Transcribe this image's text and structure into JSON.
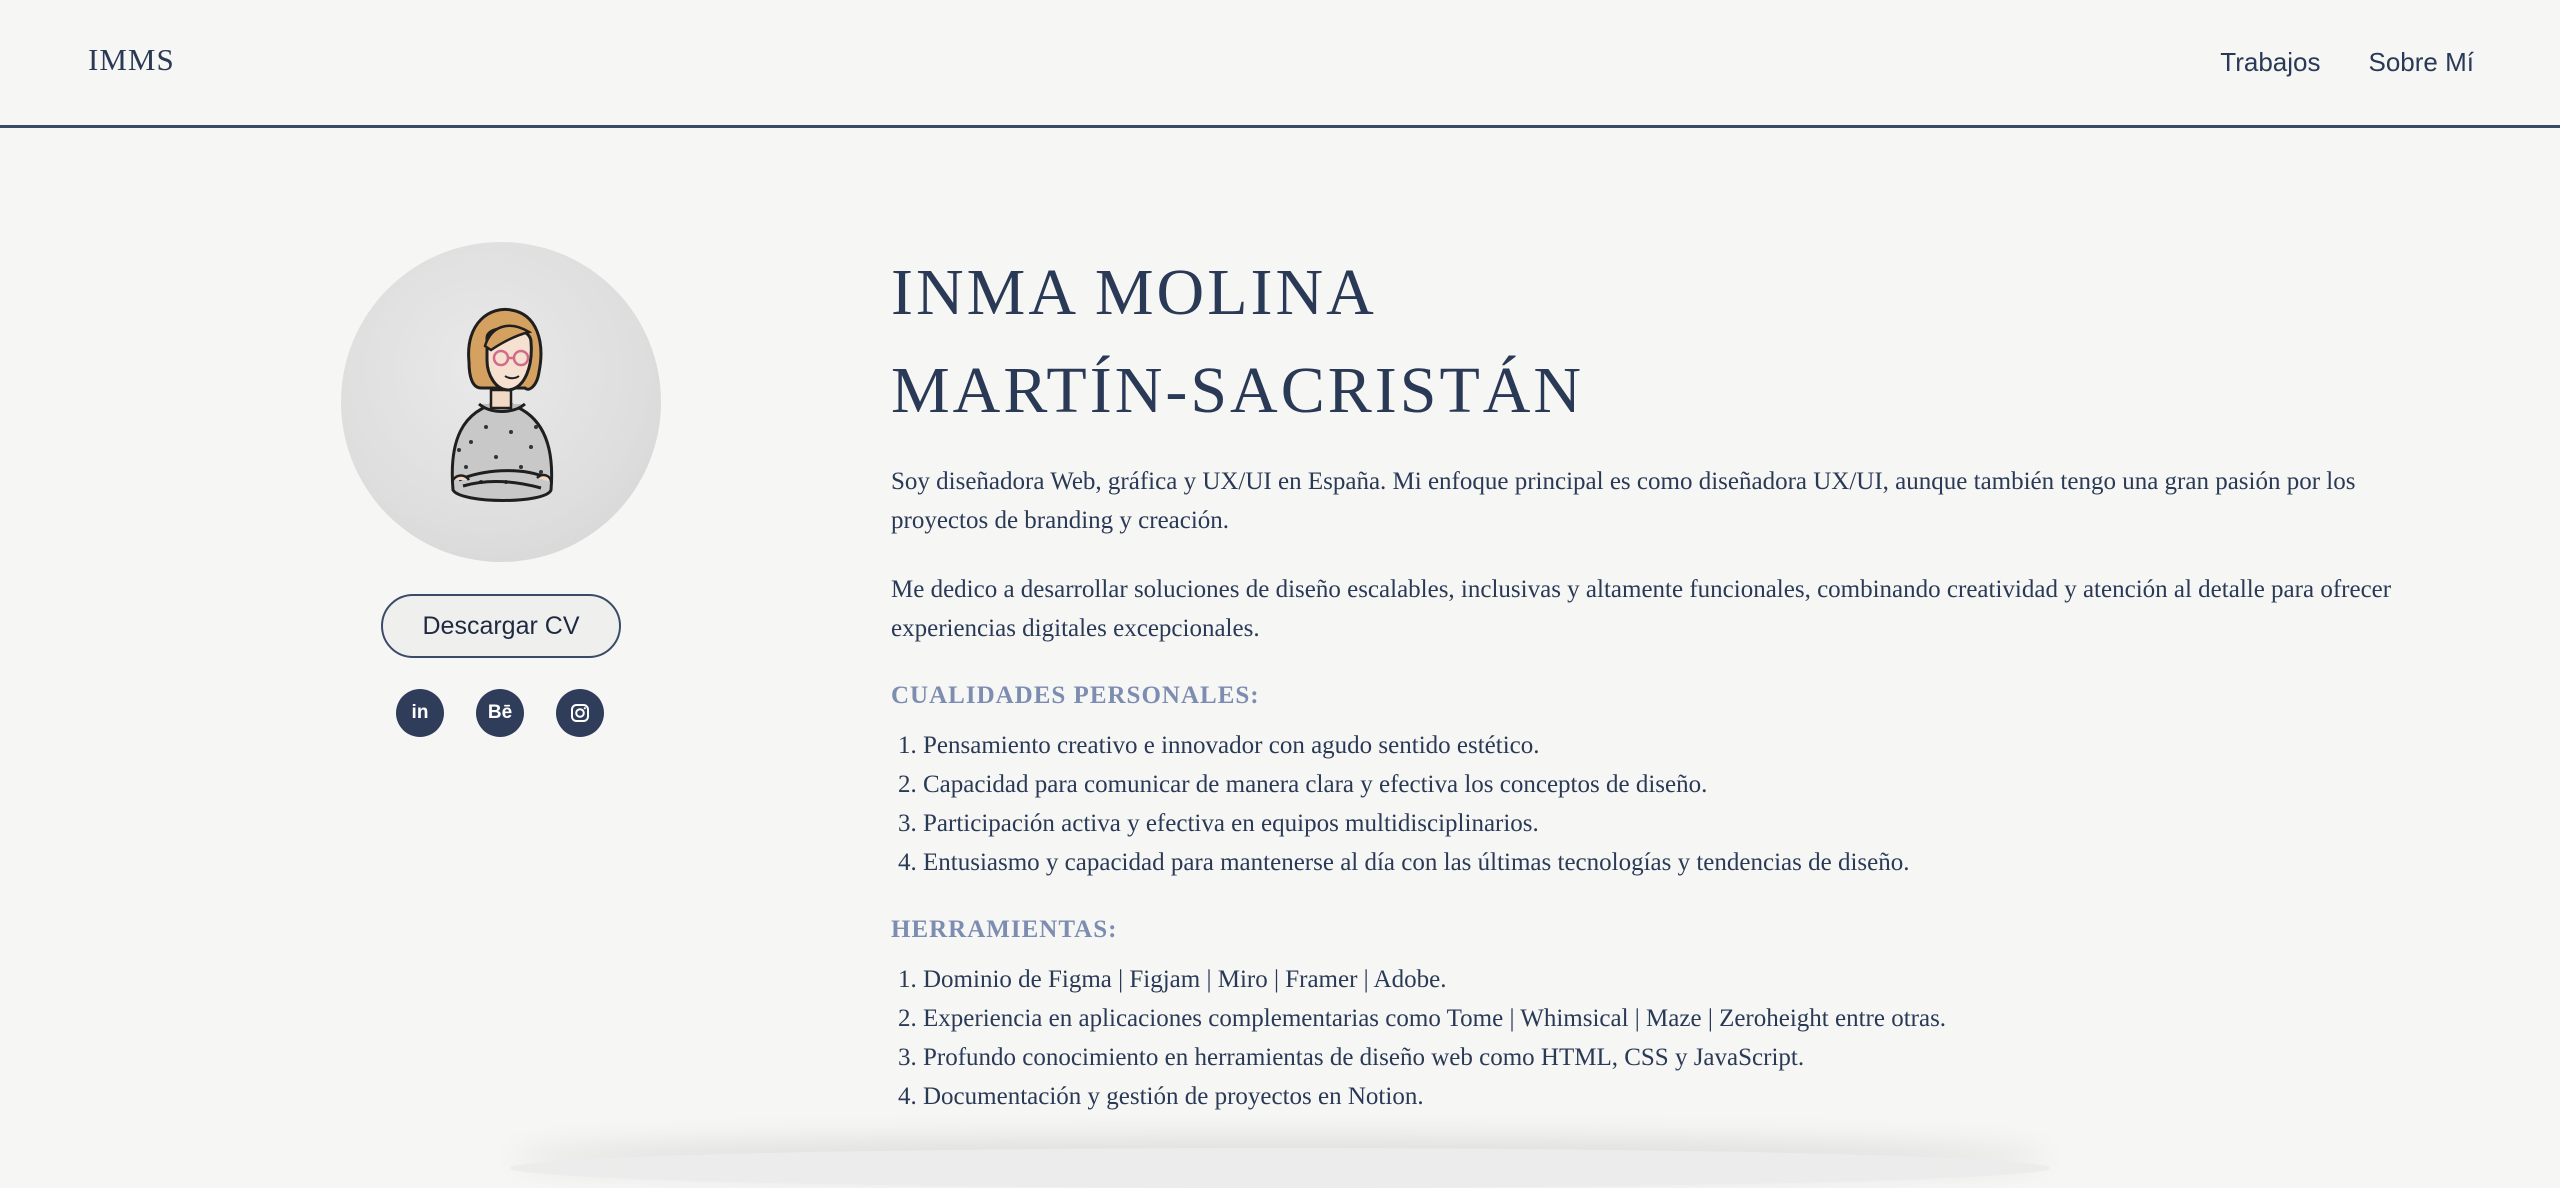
{
  "header": {
    "logo": "IMMS",
    "nav": [
      "Trabajos",
      "Sobre Mí"
    ]
  },
  "profile": {
    "cv_button": "Descargar CV",
    "socials": [
      {
        "icon": "linkedin-icon",
        "label": "in"
      },
      {
        "icon": "behance-icon",
        "label": "Bē"
      },
      {
        "icon": "instagram-icon",
        "label": ""
      }
    ]
  },
  "main": {
    "name_line1": "INMA MOLINA",
    "name_line2": "MARTÍN-SACRISTÁN",
    "intro1": "Soy diseñadora Web, gráfica y UX/UI en España. Mi enfoque principal es como diseñadora UX/UI, aunque también tengo una gran pasión por los proyectos de branding y creación.",
    "intro2": "Me dedico a desarrollar soluciones de diseño escalables, inclusivas y altamente funcionales, combinando creatividad y atención al detalle para ofrecer experiencias digitales excepcionales.",
    "qualities_title": "CUALIDADES PERSONALES:",
    "qualities": [
      "Pensamiento creativo e innovador con agudo sentido estético.",
      "Capacidad para comunicar de manera clara y efectiva los conceptos de diseño.",
      "Participación activa y efectiva en equipos multidisciplinarios.",
      "Entusiasmo y capacidad para mantenerse al día con las últimas tecnologías y tendencias de diseño."
    ],
    "tools_title": "HERRAMIENTAS:",
    "tools": [
      "Dominio de Figma | Figjam | Miro | Framer | Adobe.",
      "Experiencia en aplicaciones complementarias como Tome | Whimsical | Maze | Zeroheight entre otras.",
      "Profundo conocimiento en herramientas de diseño web como HTML, CSS y JavaScript.",
      "Documentación y gestión de proyectos en Notion."
    ]
  },
  "colors": {
    "background": "#f6f6f4",
    "primary": "#2a3a56",
    "accent": "#7d8db1"
  }
}
